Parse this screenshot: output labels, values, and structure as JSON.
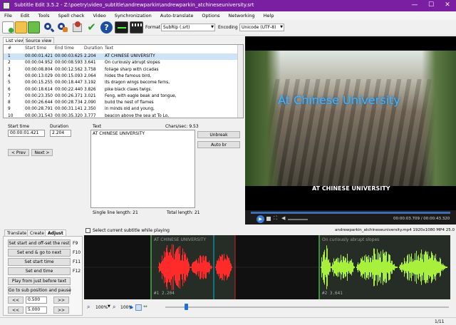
{
  "window": {
    "title": "Subtitle Edit 3.5.2 - Z:\\poetry\\video_subtitle\\andrewparkin\\andrewparkin_atchineseuniversity.srt",
    "minimize": "—",
    "maximize": "☐",
    "close": "✕"
  },
  "menu": [
    "File",
    "Edit",
    "Tools",
    "Spell check",
    "Video",
    "Synchronization",
    "Auto-translate",
    "Options",
    "Networking",
    "Help"
  ],
  "toolbar": {
    "format_label": "Format",
    "format_value": "SubRip (.srt)",
    "encoding_label": "Encoding",
    "encoding_value": "Unicode (UTF-8)"
  },
  "view_tabs": [
    "List view",
    "Source view"
  ],
  "grid": {
    "headers": [
      "#",
      "Start time",
      "End time",
      "Duration",
      "Text"
    ],
    "rows": [
      [
        "1",
        "00:00:01.421",
        "00:00:03.625",
        "2.204",
        "AT CHINESE UNIVERSITY"
      ],
      [
        "2",
        "00:00:04.952",
        "00:00:08.593",
        "3.641",
        "On curiously abrupt slopes"
      ],
      [
        "3",
        "00:00:08.804",
        "00:00:12.562",
        "3.758",
        "foliage sharp with cicadas"
      ],
      [
        "4",
        "00:00:13.029",
        "00:00:15.093",
        "2.064",
        "hides the famous bird,"
      ],
      [
        "5",
        "00:00:15.255",
        "00:00:18.447",
        "3.192",
        "its dragon wings become ferns,"
      ],
      [
        "6",
        "00:00:18.614",
        "00:00:22.440",
        "3.826",
        "pike black claws twigs."
      ],
      [
        "7",
        "00:00:23.350",
        "00:00:26.371",
        "3.021",
        "Feng, with eagle beak and tongue,"
      ],
      [
        "8",
        "00:00:26.644",
        "00:00:28.734",
        "2.090",
        "build the nest of flames"
      ],
      [
        "9",
        "00:00:28.791",
        "00:00:31.141",
        "2.350",
        "in minds old and young,"
      ],
      [
        "10",
        "00:00:31.543",
        "00:00:35.320",
        "3.777",
        "beacon above the sea at To Lo,"
      ]
    ]
  },
  "editor": {
    "start_time_label": "Start time",
    "start_time_value": "00:00:01.421",
    "duration_label": "Duration",
    "duration_value": "2.204",
    "text_label": "Text",
    "chars_sec": "Chars/sec: 9.53",
    "text_value": "AT CHINESE UNIVERSITY",
    "prev_button": "< Prev",
    "next_button": "Next >",
    "unbreak_button": "Unbreak",
    "autobr_button": "Auto br",
    "single_line_length": "Single line length: 21",
    "total_length": "Total length: 21"
  },
  "video": {
    "overlay_text": "At Chinese University",
    "subtitle_text": "AT CHINESE UNIVERSITY",
    "time_display": "00:00:03.709 / 00:00:43.320"
  },
  "bottom_tabs": [
    "Translate",
    "Create",
    "Adjust"
  ],
  "adjust": {
    "buttons": [
      {
        "label": "Set start and off-set the rest",
        "key": "F9"
      },
      {
        "label": "Set end & go to next",
        "key": "F10"
      },
      {
        "label": "Set start time",
        "key": "F11"
      },
      {
        "label": "Set end time",
        "key": "F12"
      },
      {
        "label": "Play from just before text",
        "key": ""
      },
      {
        "label": "Go to sub position and pause",
        "key": ""
      }
    ],
    "rewind": "<<",
    "forward": ">>",
    "step1": "0.500",
    "step2": "5.000"
  },
  "waveform": {
    "select_checkbox_label": "Select current subtitle while playing",
    "file_info": "andrewparkin_atchineseuniversity.mp4 1920x1080 MP4 25.0",
    "sub1_text": "AT CHINESE UNIVERSITY",
    "sub2_text": "On curiously abrupt slopes",
    "sub1_info": "#1  2.204",
    "sub2_info": "#2  3.641",
    "zoom": "100%",
    "zoom2": "100%"
  },
  "status": {
    "position": "1/11"
  },
  "colors": {
    "titlebar": "#7b1fa2",
    "selection": "#cfe3f7",
    "wave_active": "#ff2a2a",
    "wave_next": "#a8f03c",
    "overlay_text": "#3fb4ff"
  }
}
